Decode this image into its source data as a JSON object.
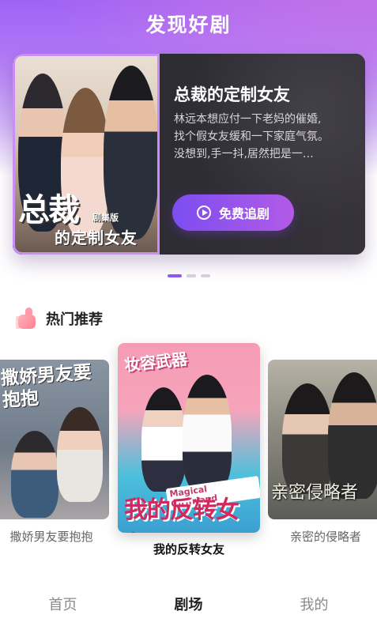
{
  "header": {
    "title": "发现好剧"
  },
  "banner": {
    "poster_title": "总裁",
    "poster_tag": "剧集版",
    "poster_subtitle": "的定制女友",
    "title": "总裁的定制女友",
    "description_lines": [
      "林远本想应付一下老妈的催婚,",
      "找个假女友缓和一下家庭气氛。",
      "没想到,手一抖,居然把是一…"
    ],
    "cta_label": "免费追剧",
    "pager": {
      "count": 3,
      "active_index": 0
    }
  },
  "recommend": {
    "title": "热门推荐",
    "cards": [
      {
        "label": "撒娇男友要抱抱",
        "poster_text": "撒娇男友要抱抱",
        "position": "left"
      },
      {
        "label": "我的反转女友",
        "poster_text": "我的反转女友",
        "poster_top_text": "妆容武器",
        "poster_magical": "Magical Girlfriend",
        "position": "center"
      },
      {
        "label": "亲密的侵略者",
        "poster_text": "亲密侵略者",
        "position": "right"
      }
    ]
  },
  "nav": {
    "items": [
      "首页",
      "剧场",
      "我的"
    ],
    "active": "剧场"
  },
  "colors": {
    "accent": "#8d5df1",
    "cta_start": "#7c4df0",
    "cta_end": "#b25be6"
  }
}
